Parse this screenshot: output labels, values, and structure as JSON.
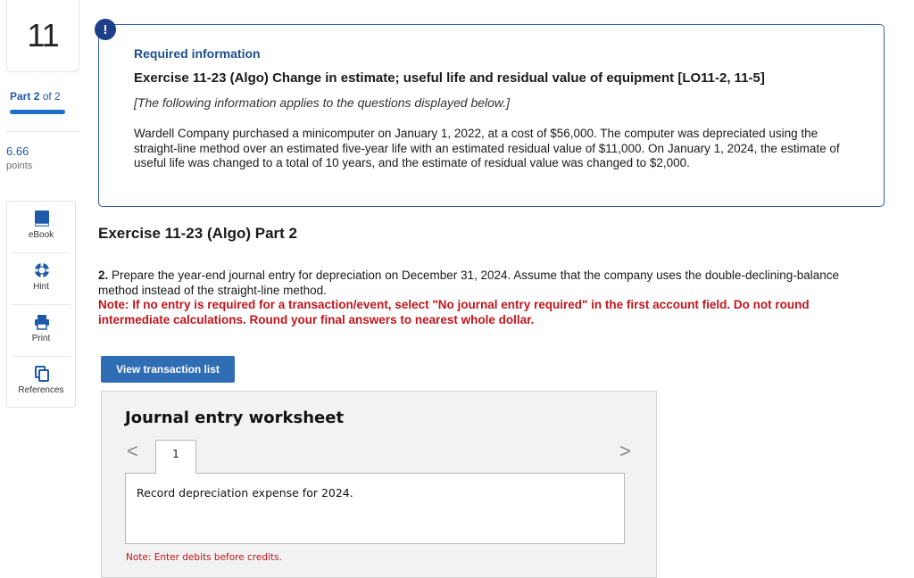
{
  "rail": {
    "question_number": "11",
    "part_label_prefix": "Part",
    "part_current": "2",
    "part_of": "of 2",
    "points_value": "6.66",
    "points_label": "points",
    "tools": [
      {
        "label": "eBook",
        "icon": "book-icon"
      },
      {
        "label": "Hint",
        "icon": "lifebuoy-icon"
      },
      {
        "label": "Print",
        "icon": "printer-icon"
      },
      {
        "label": "References",
        "icon": "copy-icon"
      }
    ]
  },
  "alert": {
    "symbol": "!"
  },
  "required_info": {
    "heading": "Required information",
    "exercise_title": "Exercise 11-23 (Algo) Change in estimate; useful life and residual value of equipment [LO11-2, 11-5]",
    "applies_note": "[The following information applies to the questions displayed below.]",
    "scenario": "Wardell Company purchased a minicomputer on January 1, 2022, at a cost of $56,000. The computer was depreciated using the straight-line method over an estimated five-year life with an estimated residual value of $11,000. On January 1, 2024, the estimate of useful life was changed to a total of 10 years, and the estimate of residual value was changed to $2,000."
  },
  "part_heading": "Exercise 11-23 (Algo) Part 2",
  "question": {
    "number": "2.",
    "text": " Prepare the year-end journal entry for depreciation on December 31, 2024. Assume that the company uses the double-declining-balance method instead of the straight-line method.",
    "note": "Note: If no entry is required for a transaction/event, select \"No journal entry required\" in the first account field. Do not round intermediate calculations. Round your final answers to nearest whole dollar."
  },
  "view_button_label": "View transaction list",
  "worksheet": {
    "title": "Journal entry worksheet",
    "prev_symbol": "<",
    "next_symbol": ">",
    "tab_label": "1",
    "description": "Record depreciation expense for 2024.",
    "note": "Note: Enter debits before credits."
  }
}
